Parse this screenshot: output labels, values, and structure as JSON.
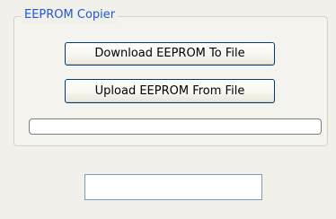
{
  "group": {
    "title": "EEPROM Copier"
  },
  "buttons": {
    "download_label": "Download EEPROM To File",
    "upload_label": "Upload EEPROM From File"
  },
  "progress": {
    "value_percent": 0
  },
  "status": {
    "value": ""
  }
}
